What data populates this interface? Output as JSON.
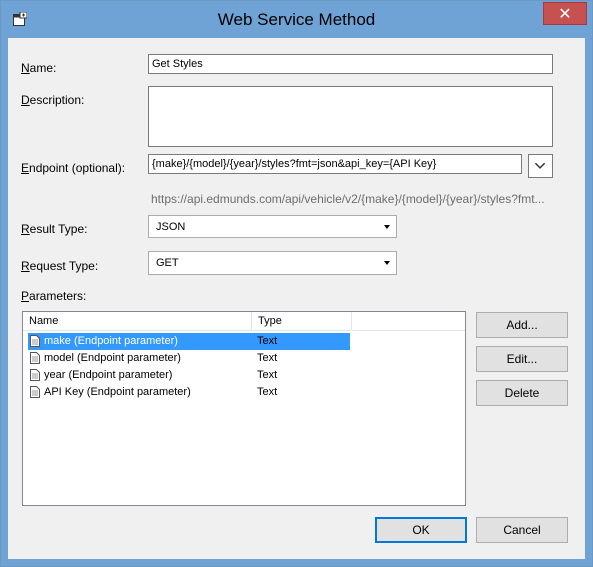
{
  "window": {
    "title": "Web Service Method",
    "close_glyph": "✕"
  },
  "form": {
    "name_label_prefix": "N",
    "name_label_rest": "ame:",
    "name_value": "Get Styles",
    "description_label_prefix": "D",
    "description_label_rest": "escription:",
    "description_value": "",
    "endpoint_label_prefix": "E",
    "endpoint_label_rest": "ndpoint (optional):",
    "endpoint_value": "{make}/{model}/{year}/styles?fmt=json&api_key={API Key}",
    "endpoint_full_url": "https://api.edmunds.com/api/vehicle/v2/{make}/{model}/{year}/styles?fmt...",
    "result_type_label_prefix": "R",
    "result_type_label_rest": "esult Type:",
    "result_type_value": "JSON",
    "request_type_label_prefix": "R",
    "request_type_label_rest": "equest Type:",
    "request_type_value": "GET",
    "parameters_label_prefix": "P",
    "parameters_label_rest": "arameters:"
  },
  "parameters": {
    "columns": [
      "Name",
      "Type"
    ],
    "rows": [
      {
        "name": "make (Endpoint parameter)",
        "type": "Text",
        "selected": true
      },
      {
        "name": "model (Endpoint parameter)",
        "type": "Text",
        "selected": false
      },
      {
        "name": "year (Endpoint parameter)",
        "type": "Text",
        "selected": false
      },
      {
        "name": "API Key (Endpoint parameter)",
        "type": "Text",
        "selected": false
      }
    ]
  },
  "buttons": {
    "add": "Add...",
    "edit": "Edit...",
    "delete": "Delete",
    "ok": "OK",
    "cancel": "Cancel"
  },
  "icons": {
    "app": "form-window-icon",
    "expand": "chevron-down-icon",
    "row": "document-icon"
  },
  "colors": {
    "titlebar": "#6fa3d6",
    "close": "#c75050",
    "selection": "#3399ff",
    "client": "#f0f0f0"
  }
}
